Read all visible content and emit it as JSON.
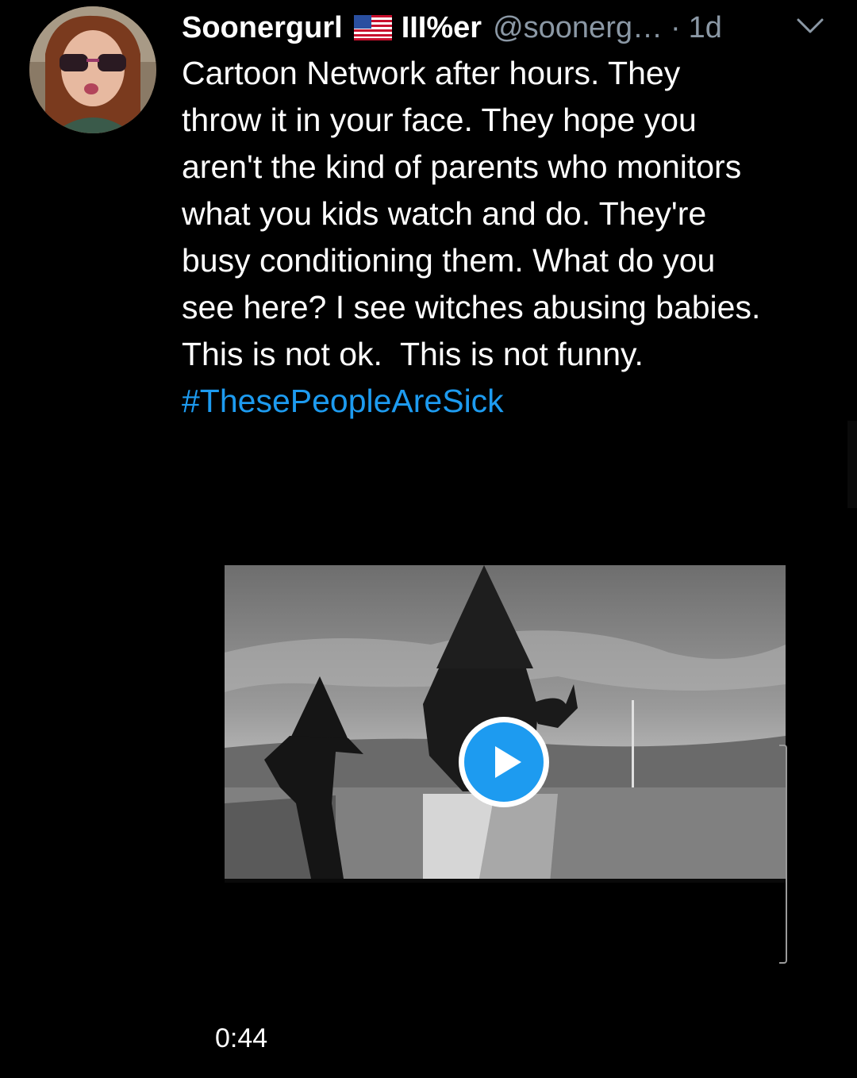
{
  "tweet": {
    "display_name": "Soonergurl",
    "flag_icon": "us-flag-icon",
    "name_suffix": "III%er",
    "handle": "@soonerg…",
    "separator": "·",
    "time_ago": "1d",
    "menu_icon": "chevron-down-icon",
    "body_lines": [
      "Cartoon Network after hours. They",
      "throw it in your face. They hope you",
      "aren't the kind of parents who monitors",
      "what you kids watch and do. They're",
      "busy conditioning them. What do you",
      "see here? I see witches abusing babies.",
      "This is not ok.  This is not funny."
    ],
    "hashtag": "#ThesePeopleAreSick",
    "video": {
      "play_icon": "play-icon",
      "duration": "0:44"
    }
  },
  "colors": {
    "background": "#000000",
    "text": "#ffffff",
    "muted": "#8b98a5",
    "link": "#1d9bf0",
    "play_button": "#1d9bf0"
  }
}
